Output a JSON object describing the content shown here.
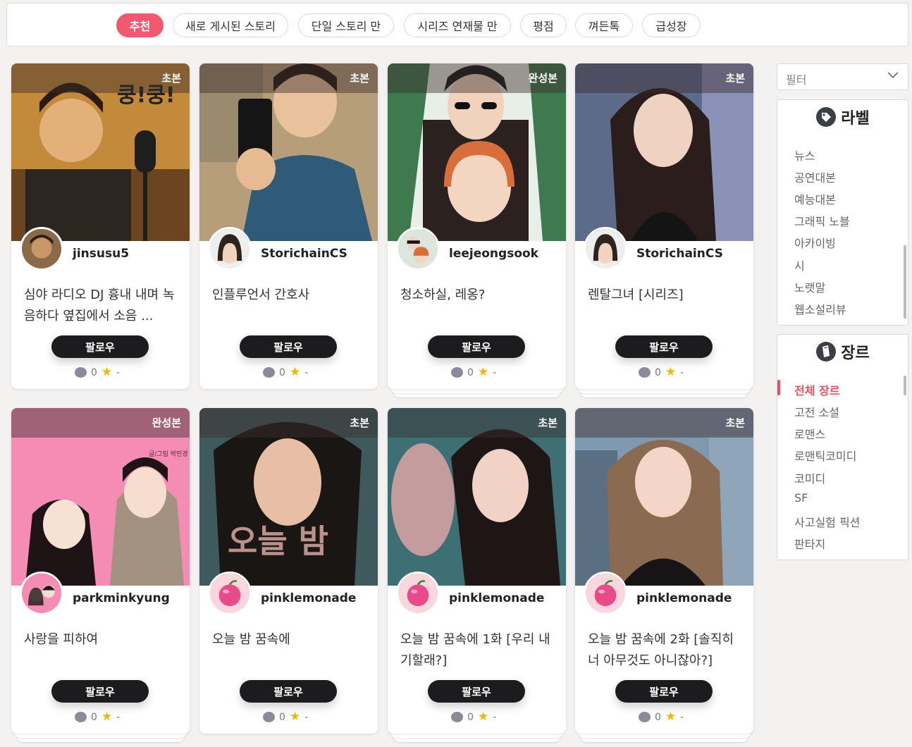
{
  "tabs": [
    {
      "label": "추천",
      "active": true
    },
    {
      "label": "새로 게시된 스토리",
      "active": false
    },
    {
      "label": "단일 스토리 만",
      "active": false
    },
    {
      "label": "시리즈 연재물 만",
      "active": false
    },
    {
      "label": "평점",
      "active": false
    },
    {
      "label": "껴든톡",
      "active": false
    },
    {
      "label": "급성장",
      "active": false
    }
  ],
  "cards": [
    {
      "badge": "초본",
      "author": "jinsusu5",
      "title": "심야 라디오 DJ 흉내 내며 녹음하다 옆집에서 소음 ...",
      "follow": "팔로우",
      "comments": "0",
      "rating": "-"
    },
    {
      "badge": "초본",
      "author": "StorichainCS",
      "title": "인플루언서 간호사",
      "follow": "팔로우",
      "comments": "0",
      "rating": "-"
    },
    {
      "badge": "완성본",
      "author": "leejeongsook",
      "title": "청소하실, 레옹?",
      "follow": "팔로우",
      "comments": "0",
      "rating": "-"
    },
    {
      "badge": "초본",
      "author": "StorichainCS",
      "title": "렌탈그녀 [시리즈]",
      "follow": "팔로우",
      "comments": "0",
      "rating": "-"
    },
    {
      "badge": "완성본",
      "author": "parkminkyung",
      "title": "사랑을 피하여",
      "follow": "팔로우",
      "comments": "0",
      "rating": "-",
      "cover_text": "글/그림 박민경"
    },
    {
      "badge": "초본",
      "author": "pinklemonade",
      "title": "오늘 밤 꿈속에",
      "follow": "팔로우",
      "comments": "0",
      "rating": "-",
      "cover_text": "오늘 밤"
    },
    {
      "badge": "초본",
      "author": "pinklemonade",
      "title": "오늘 밤 꿈속에 1화 [우리 내 기할래?]",
      "follow": "팔로우",
      "comments": "0",
      "rating": "-"
    },
    {
      "badge": "초본",
      "author": "pinklemonade",
      "title": "오늘 밤 꿈속에 2화 [솔직히 너 아무것도 아니잖아?]",
      "follow": "팔로우",
      "comments": "0",
      "rating": "-"
    }
  ],
  "sidebar": {
    "filter_label": "필터",
    "labels_title": "라벨",
    "labels": [
      "뉴스",
      "공연대본",
      "예능대본",
      "그래픽 노블",
      "아카이빙",
      "시",
      "노랫말",
      "웹소설리뷰"
    ],
    "genres_title": "장르",
    "genres": [
      "전체 장르",
      "고전 소설",
      "로맨스",
      "로맨틱코미디",
      "코미디",
      "SF",
      "사고실험 픽션",
      "판타지"
    ],
    "selected_genre": "전체 장르"
  },
  "colors": {
    "accent": "#f0596f",
    "follow_button": "#1c1c1e",
    "star": "#f5b400"
  }
}
